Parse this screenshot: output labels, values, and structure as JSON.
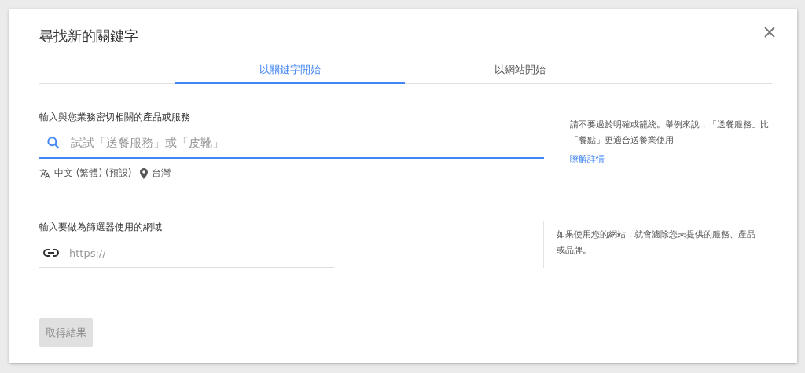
{
  "dialog": {
    "title": "尋找新的關鍵字"
  },
  "tabs": [
    {
      "label": "以關鍵字開始",
      "selected": true
    },
    {
      "label": "以網站開始",
      "selected": false
    }
  ],
  "keyword_section": {
    "label": "輸入與您業務密切相關的產品或服務",
    "placeholder": "試試「送餐服務」或「皮靴」",
    "focused": true,
    "language": "中文 (繁體) (預設)",
    "location": "台灣",
    "help": "請不要過於明確或籠統。舉例來說，「送餐服務」比「餐點」更適合送餐業使用",
    "help_link": "瞭解詳情"
  },
  "domain_section": {
    "label": "輸入要做為篩選器使用的網域",
    "placeholder": "https://",
    "focused": false,
    "help": "如果使用您的網站，就會濾除您未提供的服務、產品或品牌。"
  },
  "submit": {
    "label": "取得結果",
    "disabled": true
  }
}
